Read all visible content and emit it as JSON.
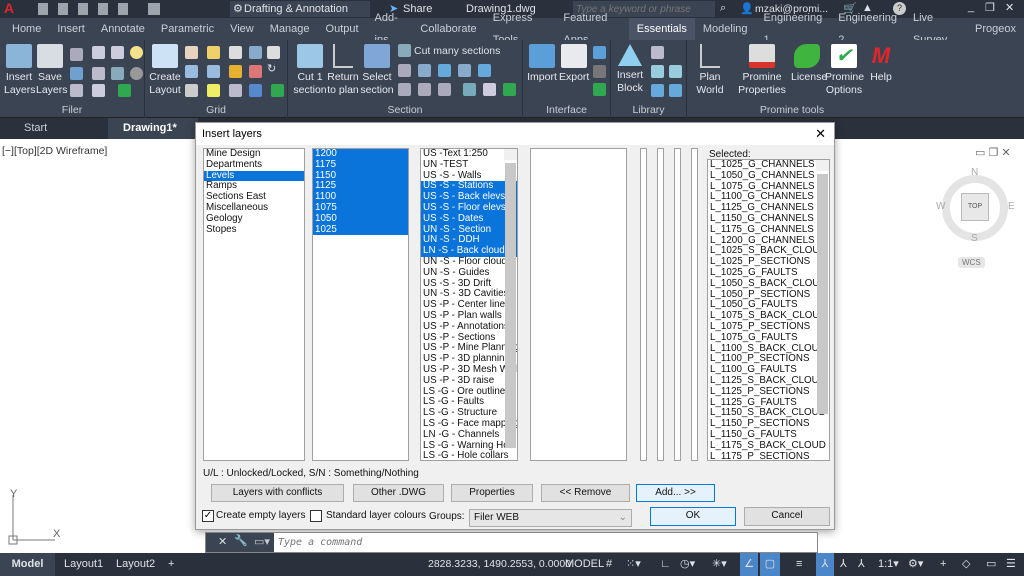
{
  "titlebar": {
    "workspace": "Drafting & Annotation",
    "share": "Share",
    "filename": "Drawing1.dwg",
    "search_placeholder": "Type a keyword or phrase",
    "user": "mzaki@promi...",
    "app_letter": "A"
  },
  "ribbon_tabs": [
    "Home",
    "Insert",
    "Annotate",
    "Parametric",
    "View",
    "Manage",
    "Output",
    "Add-ins",
    "Collaborate",
    "Express Tools",
    "Featured Apps",
    "Essentials",
    "Modeling",
    "Engineering 1",
    "Engineering 2",
    "Live Survey",
    "Progeox"
  ],
  "active_tab": "Essentials",
  "panels": {
    "filer": {
      "label": "Filer",
      "insert_layers": "Insert Layers",
      "save_layers": "Save Layers"
    },
    "grid": {
      "label": "Grid",
      "create_layout": "Create Layout"
    },
    "section": {
      "label": "Section",
      "cut1": "Cut 1 section",
      "return": "Return to plan",
      "select": "Select section",
      "cut_many": "Cut many  sections"
    },
    "interface": {
      "label": "Interface",
      "import": "Import",
      "export": "Export"
    },
    "library": {
      "label": "Library",
      "insert_block": "Insert Block"
    },
    "promine": {
      "label": "Promine tools",
      "plan_world": "Plan World",
      "properties": "Promine Properties",
      "license": "License",
      "options": "Promine Options",
      "help": "Help"
    }
  },
  "filetabs": {
    "start": "Start",
    "drawing": "Drawing1*"
  },
  "viewport_label": "[−][Top][2D Wireframe]",
  "viewcube": {
    "n": "N",
    "s": "S",
    "e": "E",
    "w": "W",
    "top": "TOP",
    "wcs": "WCS"
  },
  "dialog": {
    "title": "Insert layers",
    "categories": [
      "Mine Design",
      "Departments",
      "Levels",
      "Ramps",
      "Sections East",
      "Miscellaneous",
      "Geology",
      "Stopes"
    ],
    "categories_selected": [
      2
    ],
    "levels": [
      "1200",
      "1175",
      "1150",
      "1125",
      "1100",
      "1075",
      "1050",
      "1025"
    ],
    "levels_selected": [
      0,
      1,
      2,
      3,
      4,
      5,
      6,
      7
    ],
    "layers": [
      "US -Text 1:250",
      "UN -TEST",
      "US -S - Walls",
      "US -S - Stations",
      "US -S - Back elevs",
      "US -S - Floor elevs",
      "US -S - Dates",
      "UN -S - Section",
      "UN -S - DDH",
      "LN -S - Back cloud",
      "UN -S - Floor cloud",
      "UN -S - Guides",
      "US -S - 3D Drift",
      "UN -S - 3D Cavities",
      "US -P - Center lines",
      "US -P - Plan walls",
      "US -P - Annotations",
      "US -P - Sections",
      "US -P - Mine Planning",
      "US -P - 3D planning",
      "US -P - 3D Mesh Walls",
      "US -P - 3D raise",
      "LS -G - Ore outlines",
      "LS -G - Faults",
      "LS -G - Structure",
      "LS -G - Face mapping",
      "LN -G - Channels",
      "LS -G - Warning Hole",
      "LS -G - Hole collars"
    ],
    "layers_selected": [
      3,
      4,
      5,
      6,
      7,
      8,
      9
    ],
    "selected_label": "Selected:",
    "selected": [
      "L_1025_G_CHANNELS",
      "L_1050_G_CHANNELS",
      "L_1075_G_CHANNELS",
      "L_1100_G_CHANNELS",
      "L_1125_G_CHANNELS",
      "L_1150_G_CHANNELS",
      "L_1175_G_CHANNELS",
      "L_1200_G_CHANNELS",
      "L_1025_S_BACK_CLOUD",
      "L_1025_P_SECTIONS",
      "L_1025_G_FAULTS",
      "L_1050_S_BACK_CLOUD",
      "L_1050_P_SECTIONS",
      "L_1050_G_FAULTS",
      "L_1075_S_BACK_CLOUD",
      "L_1075_P_SECTIONS",
      "L_1075_G_FAULTS",
      "L_1100_S_BACK_CLOUD",
      "L_1100_P_SECTIONS",
      "L_1100_G_FAULTS",
      "L_1125_S_BACK_CLOUD",
      "L_1125_P_SECTIONS",
      "L_1125_G_FAULTS",
      "L_1150_S_BACK_CLOUD",
      "L_1150_P_SECTIONS",
      "L_1150_G_FAULTS",
      "L_1175_S_BACK_CLOUD",
      "L_1175_P_SECTIONS"
    ],
    "legend": "U/L : Unlocked/Locked, S/N : Something/Nothing",
    "buttons": {
      "conflicts": "Layers with conflicts",
      "other": "Other .DWG",
      "properties": "Properties",
      "remove": "<< Remove",
      "add": "Add... >>",
      "ok": "OK",
      "cancel": "Cancel"
    },
    "create_empty": {
      "label": "Create empty layers",
      "checked": true
    },
    "standard_colours": {
      "label": "Standard layer colours",
      "checked": false
    },
    "groups_label": "Groups:",
    "groups_value": "Filer WEB"
  },
  "command": {
    "placeholder": "Type a command"
  },
  "status": {
    "model_tab": "Model",
    "layout1": "Layout1",
    "layout2": "Layout2",
    "plus": "+",
    "coords": "2828.3233, 1490.2553, 0.0000",
    "model": "MODEL",
    "scale": "1:1"
  },
  "colors": {
    "accent": "#0a74da",
    "ribbon_bg": "#3b4453",
    "title_bg": "#2a313c"
  }
}
